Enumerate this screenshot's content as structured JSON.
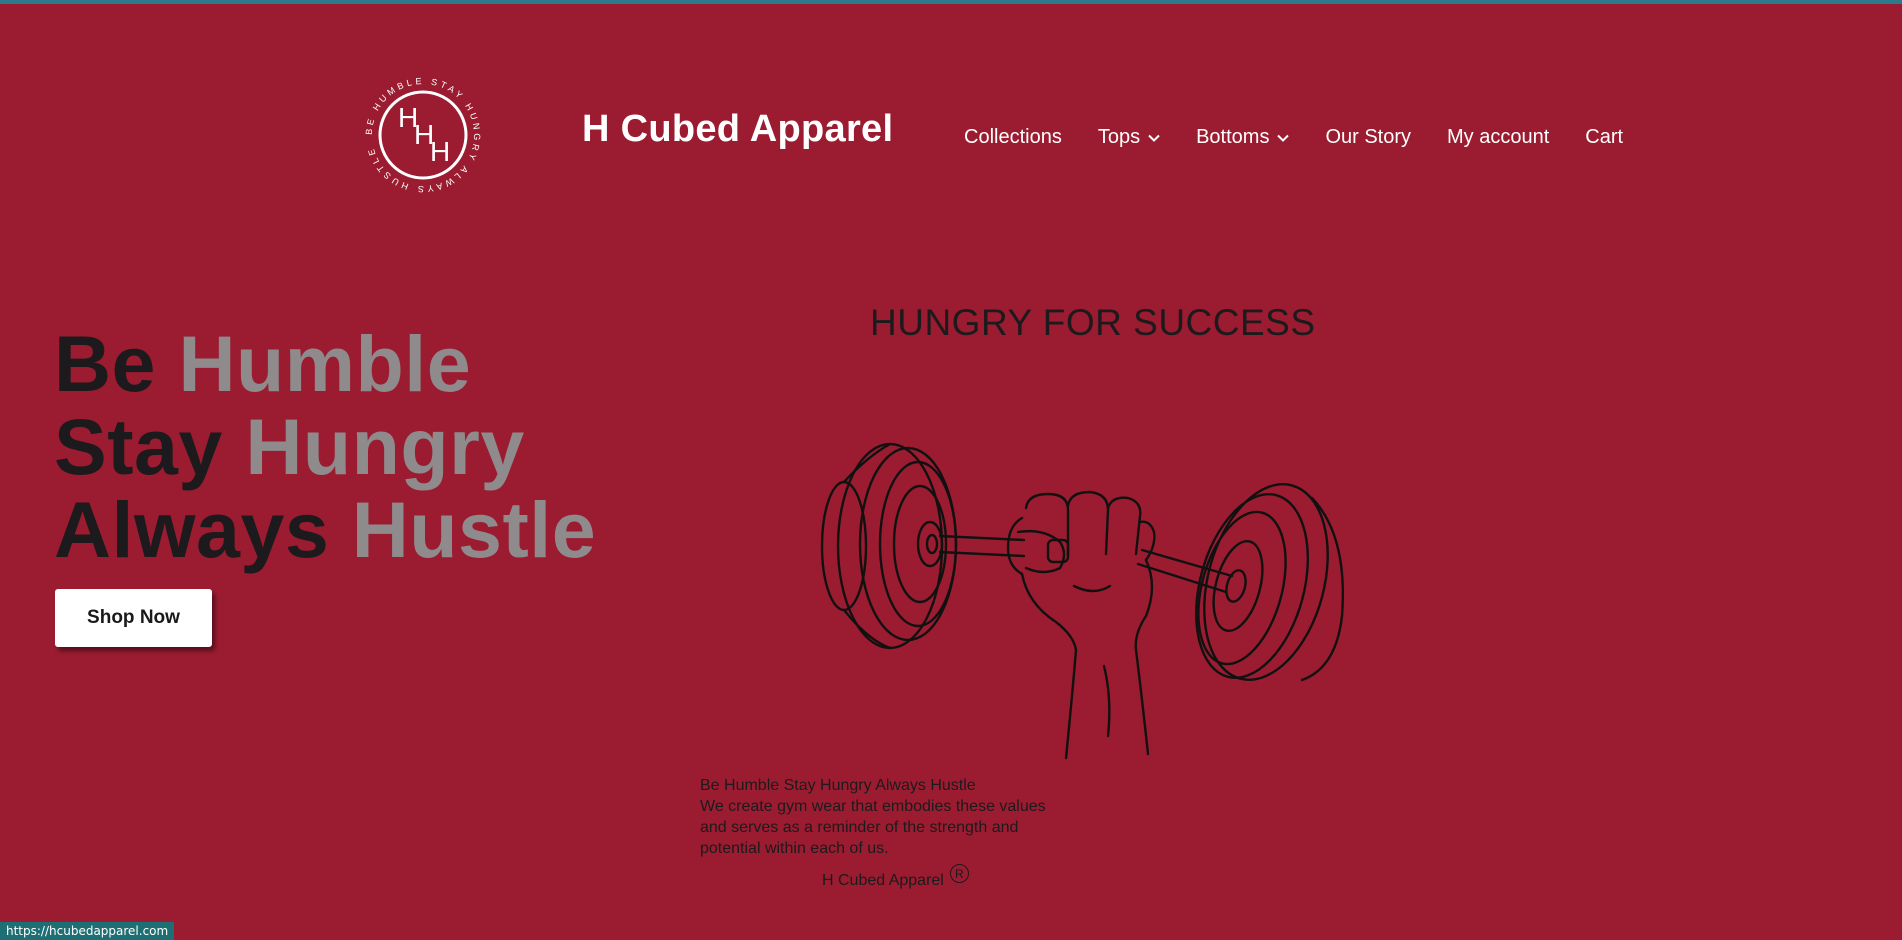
{
  "header": {
    "logo_letters": [
      "H",
      "H",
      "H"
    ],
    "logo_ring_text": "BE HUMBLE STAY HUNGRY ALWAYS HUSTLE",
    "brand": "H Cubed Apparel",
    "nav": [
      {
        "label": "Collections",
        "dropdown": false
      },
      {
        "label": "Tops",
        "dropdown": true
      },
      {
        "label": "Bottoms",
        "dropdown": true
      },
      {
        "label": "Our Story",
        "dropdown": false
      },
      {
        "label": "My account",
        "dropdown": false
      },
      {
        "label": "Cart",
        "dropdown": false
      }
    ]
  },
  "hero": {
    "lines": [
      {
        "dark": "Be",
        "grey": "Humble"
      },
      {
        "dark": "Stay",
        "grey": "Hungry"
      },
      {
        "dark": "Always",
        "grey": "Hustle"
      }
    ],
    "button": "Shop Now"
  },
  "main": {
    "tagline": "HUNGRY FOR SUCCESS",
    "image_icon": "hand-holding-dumbbell-icon",
    "description": [
      "Be Humble Stay Hungry Always Hustle",
      "We create gym wear that embodies these values",
      "and serves as a reminder of the strength and",
      "potential within each of us."
    ],
    "footer_brand": "H Cubed Apparel",
    "registered_mark": "R"
  },
  "status_bar": {
    "url": "https://hcubedapparel.com"
  },
  "colors": {
    "background": "#9b1c30",
    "dark_text": "#1c1a1c",
    "grey_text": "#8f8a8c",
    "white": "#ffffff",
    "status_bar": "#1e6f73",
    "top_bar": "#2c7a8c"
  }
}
